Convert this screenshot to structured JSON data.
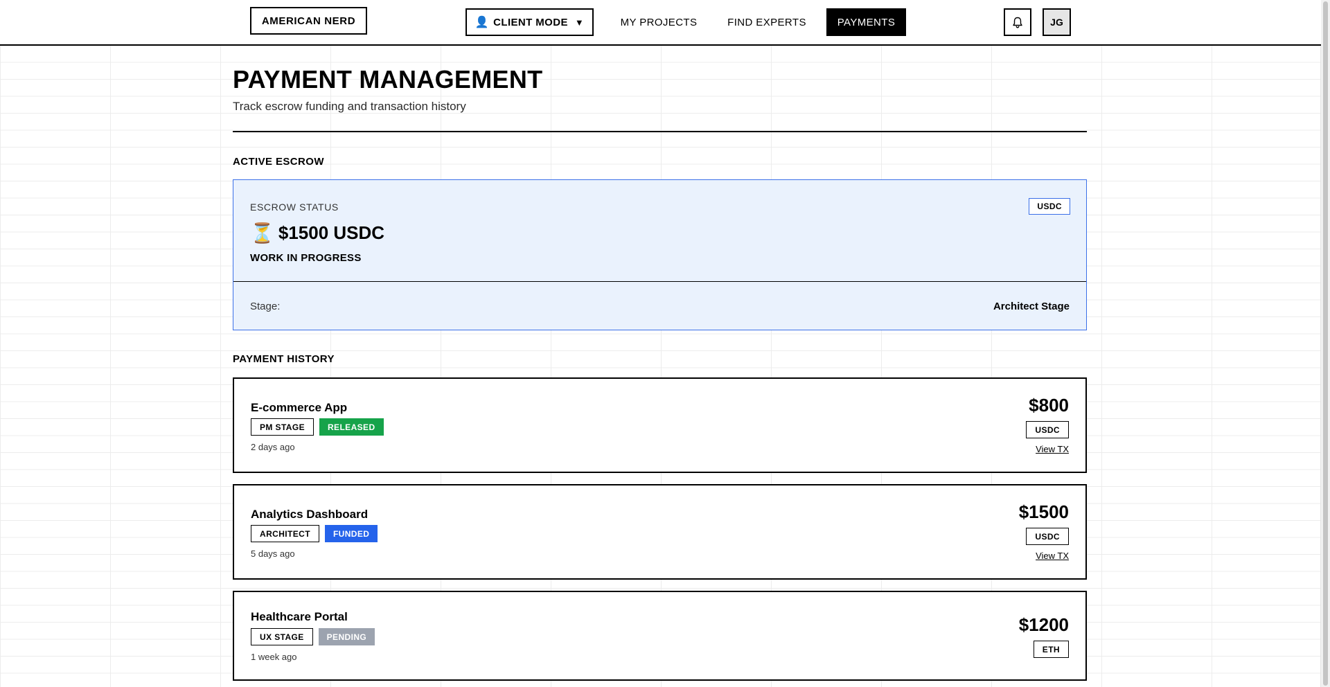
{
  "header": {
    "brand": "AMERICAN NERD",
    "mode_icon": "👤",
    "mode_label": "CLIENT MODE",
    "mode_caret": "▼",
    "nav": {
      "projects": "MY PROJECTS",
      "experts": "FIND EXPERTS",
      "payments": "PAYMENTS"
    },
    "bell_icon": "bell-icon",
    "avatar_initials": "JG"
  },
  "page": {
    "title": "PAYMENT MANAGEMENT",
    "subtitle": "Track escrow funding and transaction history"
  },
  "active_escrow": {
    "section_label": "ACTIVE ESCROW",
    "status_label": "ESCROW STATUS",
    "status_icon": "⏳",
    "amount": "$1500 USDC",
    "state": "WORK IN PROGRESS",
    "token": "USDC",
    "stage_label": "Stage:",
    "stage_value": "Architect Stage",
    "accent_color": "#3a6fe8"
  },
  "payment_history": {
    "section_label": "PAYMENT HISTORY",
    "items": [
      {
        "project": "E-commerce App",
        "stage": "PM STAGE",
        "status": "RELEASED",
        "status_color": "#16a34a",
        "time": "2 days ago",
        "amount": "$800",
        "currency": "USDC",
        "tx_link": "View TX"
      },
      {
        "project": "Analytics Dashboard",
        "stage": "ARCHITECT",
        "status": "FUNDED",
        "status_color": "#2563eb",
        "time": "5 days ago",
        "amount": "$1500",
        "currency": "USDC",
        "tx_link": "View TX"
      },
      {
        "project": "Healthcare Portal",
        "stage": "UX STAGE",
        "status": "PENDING",
        "status_color": "#9ca3af",
        "time": "1 week ago",
        "amount": "$1200",
        "currency": "ETH"
      }
    ]
  }
}
